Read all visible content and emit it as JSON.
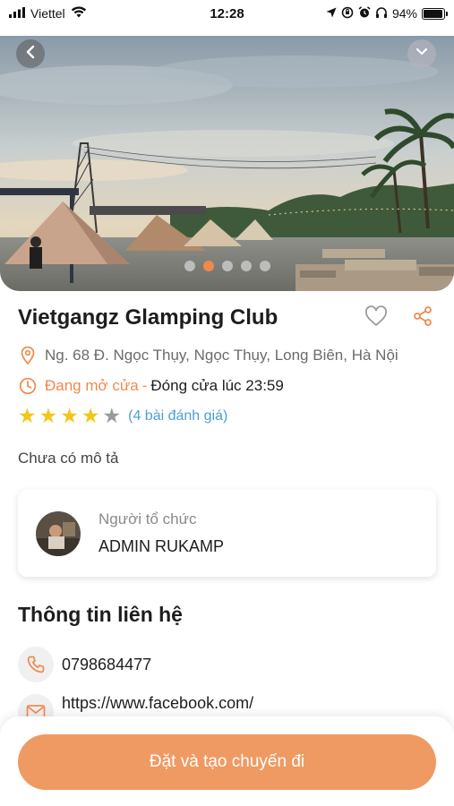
{
  "status_bar": {
    "carrier": "Viettel",
    "time": "12:28",
    "battery": "94%",
    "battery_level": 0.94,
    "icons": [
      "signal-icon",
      "wifi-icon",
      "location-arrow-icon",
      "orientation-lock-icon",
      "alarm-icon",
      "headphones-icon",
      "battery-icon"
    ]
  },
  "hero": {
    "slide_count": 5,
    "active_slide": 2,
    "icons": [
      "back-chevron-icon",
      "collapse-chevron-icon"
    ]
  },
  "place": {
    "name": "Vietgangz Glamping Club",
    "address": "Ng. 68 Đ. Ngọc Thụy, Ngọc Thụy, Long Biên, Hà Nội",
    "status_open": "Đang mở cửa",
    "separator": "-",
    "closing_time": "Đóng cửa lúc 23:59",
    "rating_value": 4,
    "rating_max": 5,
    "reviews_text": "(4 bài đánh giá)",
    "description": "Chưa có mô tả"
  },
  "organizer": {
    "label": "Người tổ chức",
    "name": "ADMIN RUKAMP"
  },
  "contact": {
    "section_title": "Thông tin liên hệ",
    "phone": "0798684477",
    "facebook": "https://www.facebook.com/"
  },
  "cta": {
    "book_label": "Đặt và tạo chuyến đi"
  },
  "colors": {
    "accent": "#ef8a4c",
    "button": "#ef9a62",
    "star_filled": "#f5c518",
    "star_empty": "#9a9a9a",
    "link": "#4a9fd8"
  }
}
